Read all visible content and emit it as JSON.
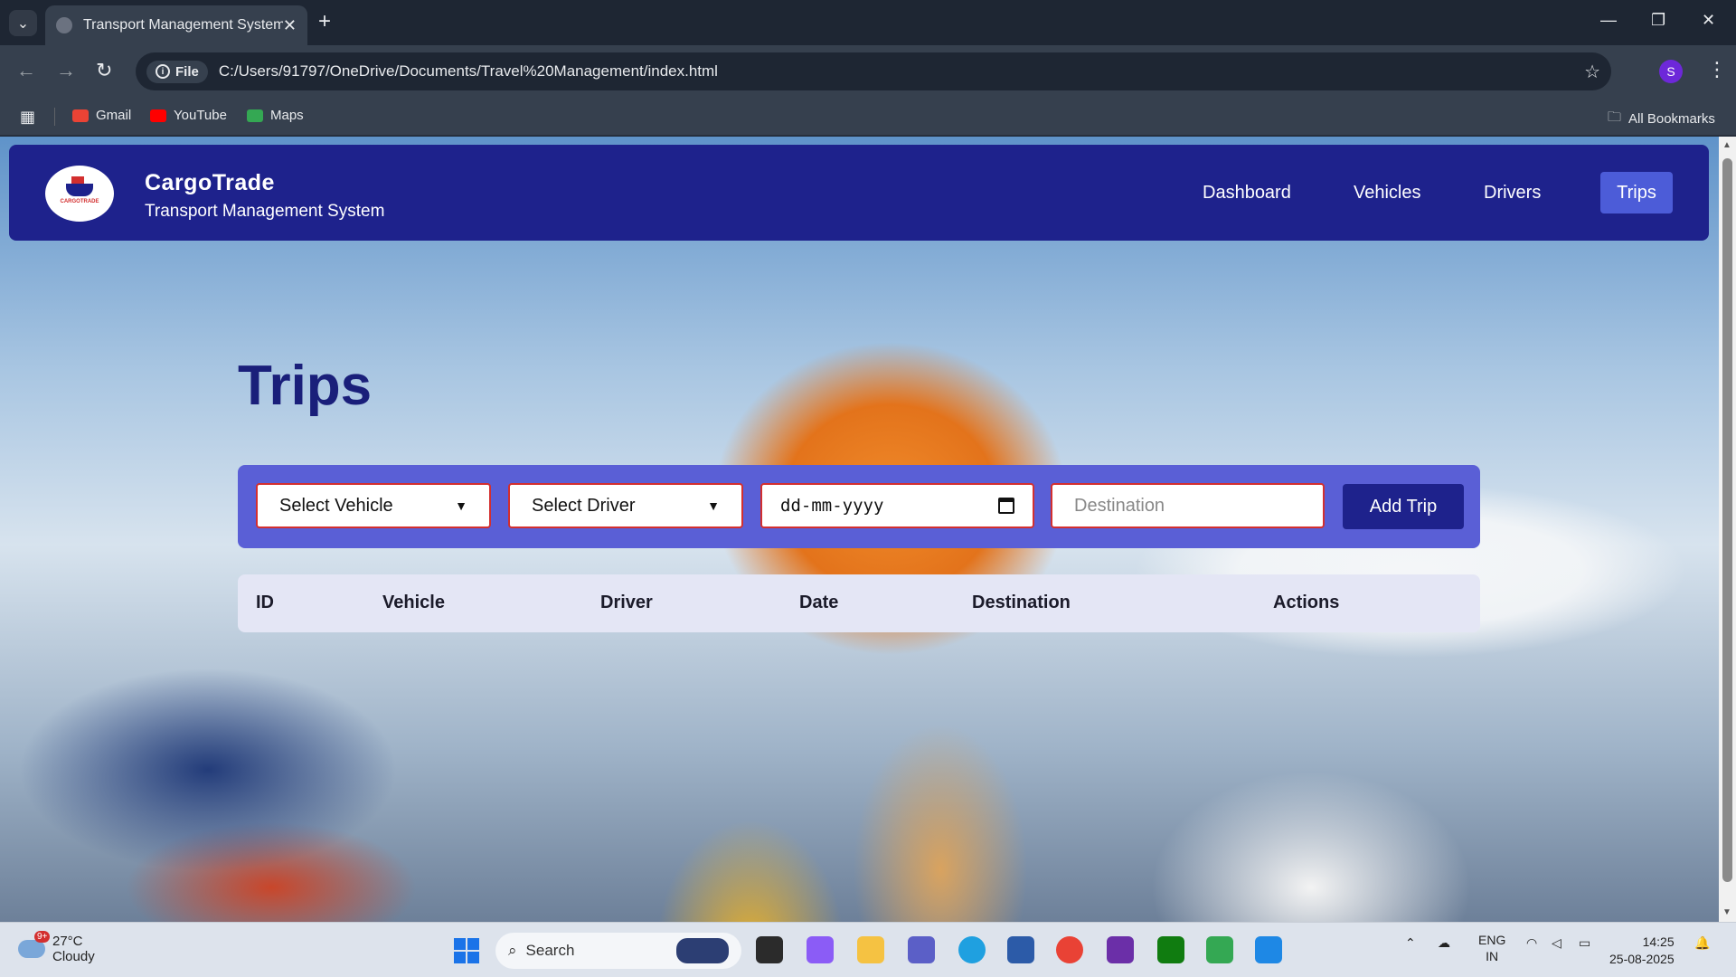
{
  "browser": {
    "tab_title": "Transport Management System",
    "address_chip": "File",
    "url": "C:/Users/91797/OneDrive/Documents/Travel%20Management/index.html",
    "profile_initial": "S",
    "bookmarks": [
      {
        "label": "Gmail",
        "color": "#ea4335"
      },
      {
        "label": "YouTube",
        "color": "#ff0000"
      },
      {
        "label": "Maps",
        "color": "#34a853"
      }
    ],
    "all_bookmarks": "All Bookmarks"
  },
  "header": {
    "brand_name": "CargoTrade",
    "brand_subtitle": "Transport Management System",
    "logo_text": "CARGOTRADE",
    "nav": [
      "Dashboard",
      "Vehicles",
      "Drivers",
      "Trips"
    ],
    "active_nav": "Trips"
  },
  "trips": {
    "title": "Trips",
    "form": {
      "vehicle_select": "Select Vehicle",
      "driver_select": "Select Driver",
      "date_placeholder": "dd-mm-yyyy",
      "destination_placeholder": "Destination",
      "add_button": "Add Trip"
    },
    "table": {
      "columns": [
        "ID",
        "Vehicle",
        "Driver",
        "Date",
        "Destination",
        "Actions"
      ],
      "rows": []
    }
  },
  "taskbar": {
    "weather_temp": "27°C",
    "weather_desc": "Cloudy",
    "weather_badge": "9+",
    "search_label": "Search",
    "lang_top": "ENG",
    "lang_bottom": "IN",
    "time": "14:25",
    "date": "25-08-2025"
  },
  "colors": {
    "header_bg": "#1e228c",
    "active_nav": "#4c5cd8",
    "form_bar": "#5a5fd6",
    "field_border": "#d32f2f",
    "title": "#1a1f7a"
  }
}
